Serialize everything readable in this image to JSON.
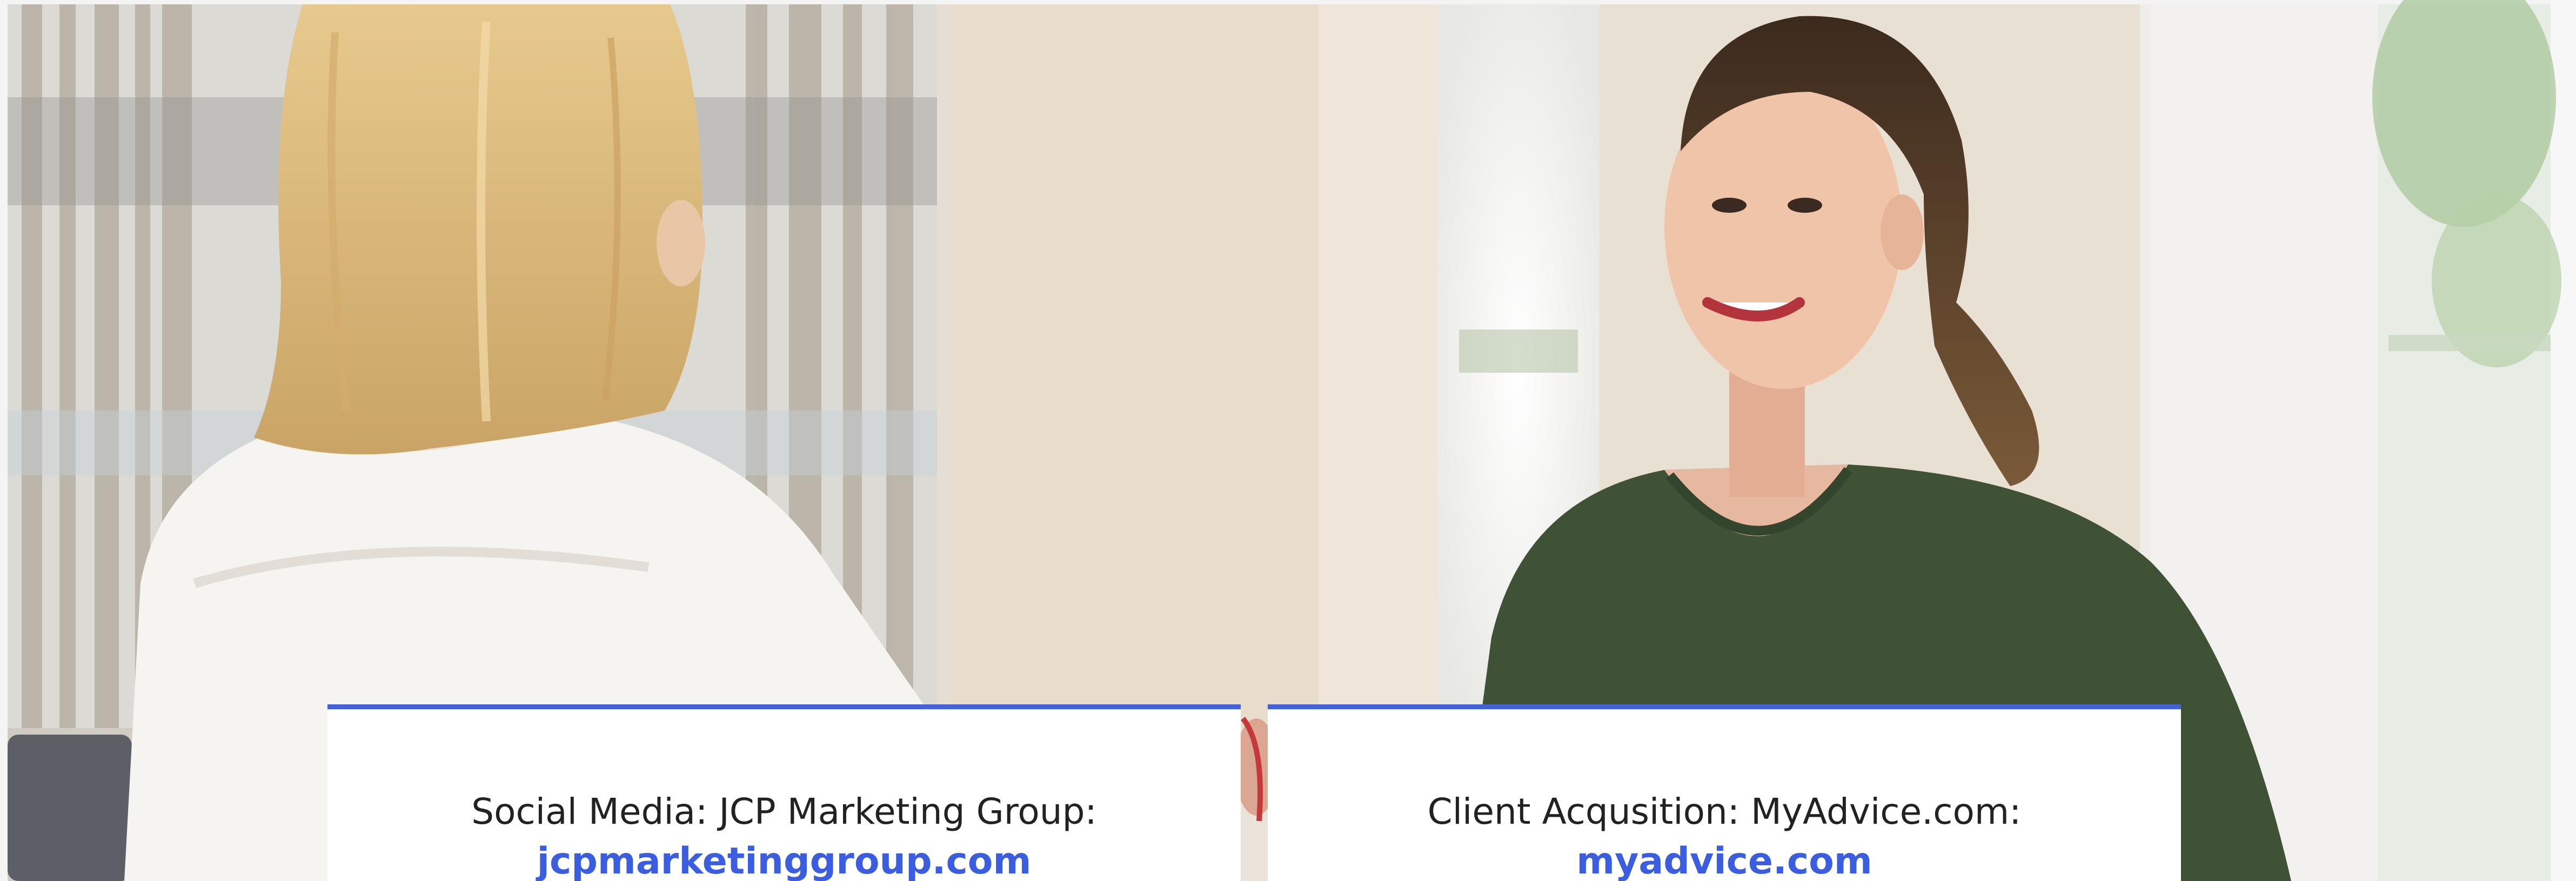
{
  "hero": {
    "image_description_icon": "photo-two-women-handshake"
  },
  "cards": [
    {
      "title": "Social Media: JCP Marketing Group:",
      "link_text": "jcpmarketinggroup.com"
    },
    {
      "title": "Client Acqusition: MyAdvice.com:",
      "link_text": "myadvice.com"
    }
  ],
  "colors": {
    "accent": "#4361d9",
    "link": "#3b5de0",
    "text": "#222222",
    "card_bg": "#ffffff"
  }
}
